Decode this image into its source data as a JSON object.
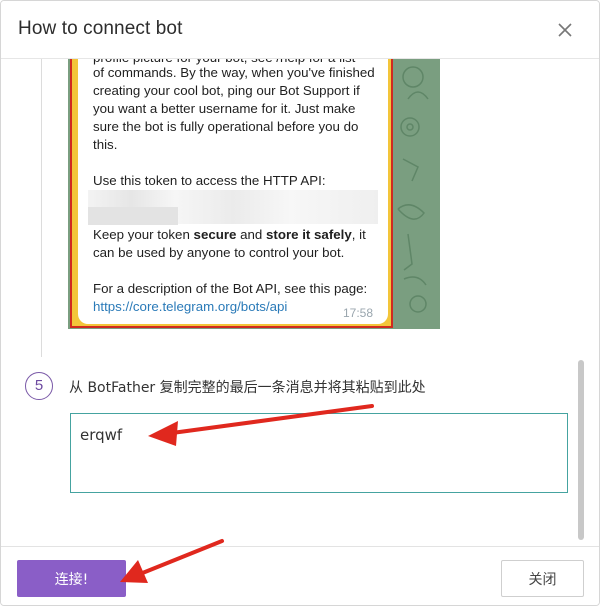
{
  "dialog": {
    "title": "How to connect bot",
    "close_icon": "close-icon"
  },
  "telegram_message": {
    "line_top": "profile picture for your bot, see /help for a list",
    "para1": "of commands. By the way, when you've finished creating your cool bot, ping our Bot Support if you want a better username for it. Just make sure the bot is fully operational before you do this.",
    "token_intro": "Use this token to access the HTTP API:",
    "secure_pre": "Keep your token ",
    "secure_b1": "secure",
    "secure_mid": " and ",
    "secure_b2": "store it safely",
    "secure_post": ", it can be used by anyone to control your bot.",
    "desc": "For a description of the Bot API, see this page:",
    "link": "https://core.telegram.org/bots/api",
    "time": "17:58"
  },
  "step5": {
    "number": "5",
    "label": "从 BotFather 复制完整的最后一条消息并将其粘贴到此处",
    "input_value": "erqwf"
  },
  "footer": {
    "connect_label": "连接!",
    "close_label": "关闭"
  },
  "colors": {
    "accent": "#8a5ec7",
    "input_border": "#45a3a0",
    "annotation_red": "#e0281e"
  }
}
